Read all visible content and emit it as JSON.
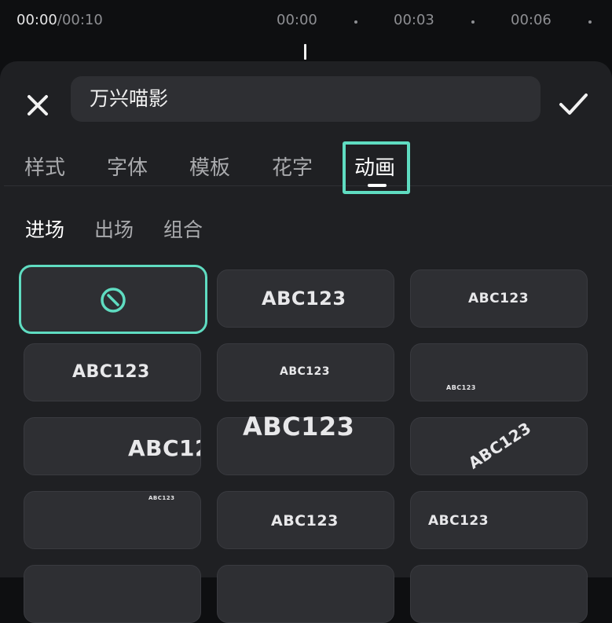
{
  "timeline": {
    "current_time": "00:00",
    "total_time": "/00:10",
    "ticks": [
      "00:00",
      "00:03",
      "00:06"
    ]
  },
  "editor": {
    "text_value": "万兴喵影",
    "close_icon": "close-icon",
    "confirm_icon": "check-icon"
  },
  "tabs": [
    {
      "label": "样式"
    },
    {
      "label": "字体"
    },
    {
      "label": "模板"
    },
    {
      "label": "花字"
    },
    {
      "label": "动画",
      "active": true
    }
  ],
  "subtabs": [
    {
      "label": "进场",
      "active": true
    },
    {
      "label": "出场"
    },
    {
      "label": "组合"
    }
  ],
  "animations": {
    "none_icon": "no-symbol-icon",
    "items": [
      {
        "label": "ABC123"
      },
      {
        "label": "ABC123"
      },
      {
        "label": "ABC123"
      },
      {
        "label": "ABC123"
      },
      {
        "label": "ABC123"
      },
      {
        "label": "ABC12"
      },
      {
        "label": "ABC123"
      },
      {
        "label": "ABC123"
      },
      {
        "label": "ABC123"
      },
      {
        "label": "ABC123"
      },
      {
        "label": "ABC123"
      }
    ]
  },
  "colors": {
    "accent": "#5fdcc1",
    "background": "#0e0f11",
    "sheet": "#1f2023",
    "tile": "#2e2f33"
  }
}
